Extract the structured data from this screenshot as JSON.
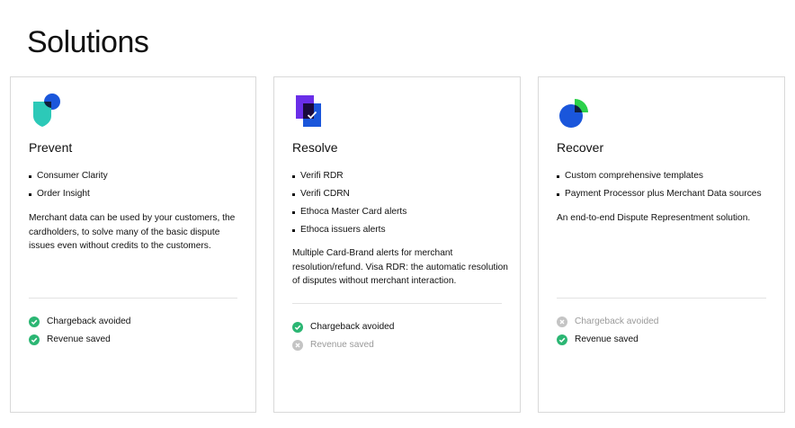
{
  "page": {
    "title": "Solutions"
  },
  "colors": {
    "check": "#2bb673",
    "muted": "#c4c4c4",
    "border": "#d9d9d9"
  },
  "cards": [
    {
      "icon": "shield-icon",
      "title": "Prevent",
      "bullets": [
        "Consumer Clarity",
        "Order Insight"
      ],
      "description": "Merchant data can be used by your customers, the cardholders, to solve many of the basic dispute issues even without credits to the customers.",
      "outcomes": [
        {
          "label": "Chargeback avoided",
          "achieved": true
        },
        {
          "label": "Revenue saved",
          "achieved": true
        }
      ]
    },
    {
      "icon": "document-check-icon",
      "title": "Resolve",
      "bullets": [
        "Verifi RDR",
        "Verifi CDRN",
        "Ethoca Master Card alerts",
        "Ethoca issuers alerts"
      ],
      "description": "Multiple Card-Brand alerts for merchant resolution/refund. Visa RDR: the automatic resolution of disputes without merchant interaction.",
      "outcomes": [
        {
          "label": "Chargeback avoided",
          "achieved": true
        },
        {
          "label": "Revenue saved",
          "achieved": false
        }
      ]
    },
    {
      "icon": "pie-chart-icon",
      "title": "Recover",
      "bullets": [
        "Custom comprehensive templates",
        "Payment Processor plus Merchant Data sources"
      ],
      "description": "An end-to-end Dispute Representment solution.",
      "outcomes": [
        {
          "label": "Chargeback avoided",
          "achieved": false
        },
        {
          "label": "Revenue saved",
          "achieved": true
        }
      ]
    }
  ]
}
